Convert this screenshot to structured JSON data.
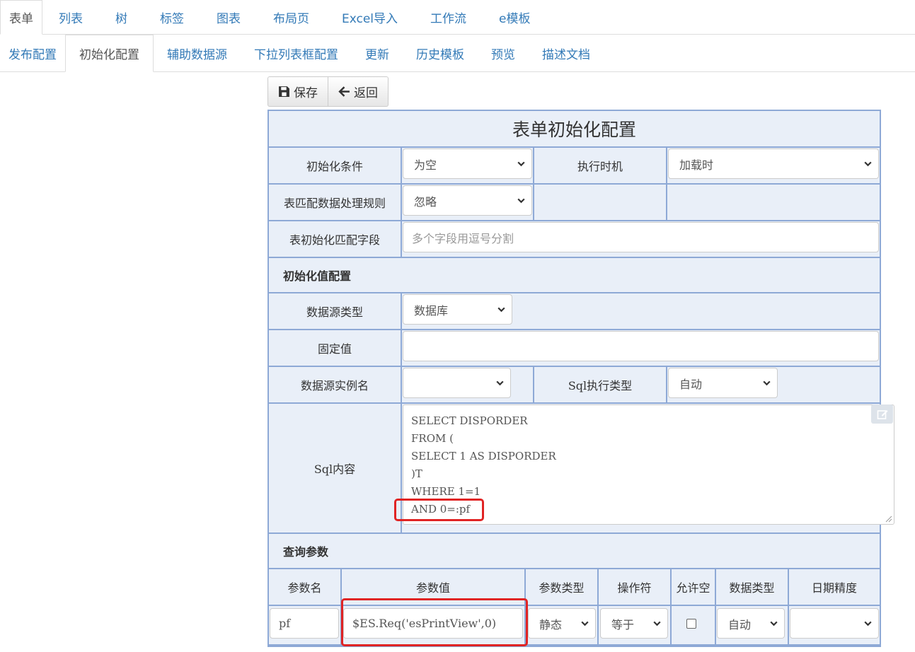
{
  "tabs_main": [
    "表单",
    "列表",
    "树",
    "标签",
    "图表",
    "布局页",
    "Excel导入",
    "工作流",
    "e模板"
  ],
  "tabs_sub": [
    "发布配置",
    "初始化配置",
    "辅助数据源",
    "下拉列表框配置",
    "更新",
    "历史模板",
    "预览",
    "描述文档"
  ],
  "toolbar": {
    "save_label": "保存",
    "back_label": "返回"
  },
  "form": {
    "title": "表单初始化配置",
    "init_condition_label": "初始化条件",
    "init_condition_value": "为空",
    "exec_timing_label": "执行时机",
    "exec_timing_value": "加载时",
    "match_rule_label": "表匹配数据处理规则",
    "match_rule_value": "忽略",
    "match_field_label": "表初始化匹配字段",
    "match_field_placeholder": "多个字段用逗号分割",
    "init_value_section": "初始化值配置",
    "datasource_type_label": "数据源类型",
    "datasource_type_value": "数据库",
    "fixed_value_label": "固定值",
    "datasource_instance_label": "数据源实例名",
    "datasource_instance_value": "",
    "sql_exec_type_label": "Sql执行类型",
    "sql_exec_type_value": "自动",
    "sql_content_label": "Sql内容",
    "sql_lines": [
      "SELECT DISPORDER",
      "FROM (",
      "SELECT 1 AS DISPORDER",
      ")T",
      "WHERE 1=1",
      "AND 0=:pf"
    ],
    "query_params_section": "查询参数",
    "param_headers": [
      "参数名",
      "参数值",
      "参数类型",
      "操作符",
      "允许空",
      "数据类型",
      "日期精度"
    ],
    "param_row": {
      "name": "pf",
      "value": "$ES.Req('esPrintView',0)",
      "type": "静态",
      "operator": "等于",
      "data_type": "自动",
      "date_precision": ""
    }
  },
  "colors": {
    "border": "#8ea9d6",
    "cell_bg": "#e9eff8",
    "link": "#337ab7",
    "highlight": "#e02424"
  }
}
